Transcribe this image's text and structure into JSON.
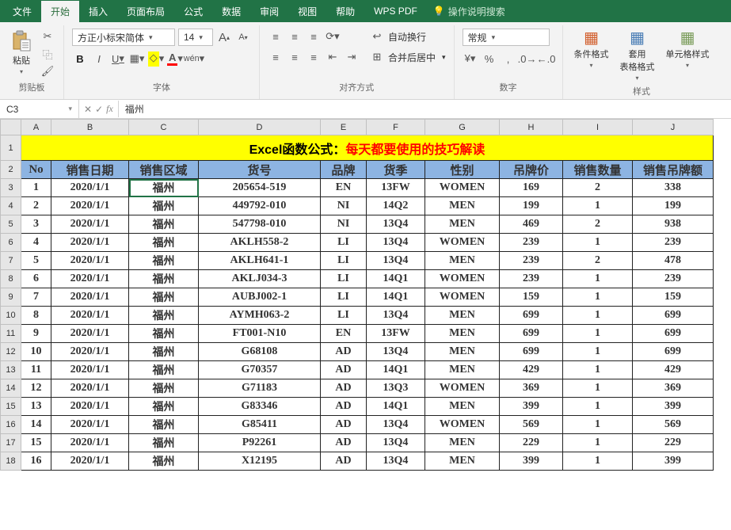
{
  "menubar": {
    "tabs": [
      "文件",
      "开始",
      "插入",
      "页面布局",
      "公式",
      "数据",
      "审阅",
      "视图",
      "帮助",
      "WPS PDF"
    ],
    "active_index": 1,
    "search_placeholder": "操作说明搜索"
  },
  "ribbon": {
    "clipboard": {
      "paste": "粘贴",
      "label": "剪贴板"
    },
    "font": {
      "family": "方正小标宋简体",
      "size": "14",
      "inc": "A",
      "dec": "A",
      "bold": "B",
      "italic": "I",
      "underline": "U",
      "label": "字体"
    },
    "align": {
      "wrap": "自动换行",
      "merge": "合并后居中",
      "label": "对齐方式"
    },
    "number": {
      "format": "常规",
      "label": "数字"
    },
    "styles": {
      "cond": "条件格式",
      "table": "套用\n表格格式",
      "cell": "单元格样式",
      "label": "样式"
    }
  },
  "formula_bar": {
    "name": "C3",
    "value": "福州"
  },
  "grid": {
    "cols": [
      "A",
      "B",
      "C",
      "D",
      "E",
      "F",
      "G",
      "H",
      "I",
      "J"
    ],
    "title_parts": [
      {
        "t": "Excel函数公式：",
        "cls": "t-blk"
      },
      {
        "t": "每天都要使用的技巧解读",
        "cls": "t-red"
      }
    ],
    "headers": [
      "No",
      "销售日期",
      "销售区域",
      "货号",
      "品牌",
      "货季",
      "性别",
      "吊牌价",
      "销售数量",
      "销售吊牌额"
    ],
    "rows": [
      [
        "1",
        "2020/1/1",
        "福州",
        "205654-519",
        "EN",
        "13FW",
        "WOMEN",
        "169",
        "2",
        "338"
      ],
      [
        "2",
        "2020/1/1",
        "福州",
        "449792-010",
        "NI",
        "14Q2",
        "MEN",
        "199",
        "1",
        "199"
      ],
      [
        "3",
        "2020/1/1",
        "福州",
        "547798-010",
        "NI",
        "13Q4",
        "MEN",
        "469",
        "2",
        "938"
      ],
      [
        "4",
        "2020/1/1",
        "福州",
        "AKLH558-2",
        "LI",
        "13Q4",
        "WOMEN",
        "239",
        "1",
        "239"
      ],
      [
        "5",
        "2020/1/1",
        "福州",
        "AKLH641-1",
        "LI",
        "13Q4",
        "MEN",
        "239",
        "2",
        "478"
      ],
      [
        "6",
        "2020/1/1",
        "福州",
        "AKLJ034-3",
        "LI",
        "14Q1",
        "WOMEN",
        "239",
        "1",
        "239"
      ],
      [
        "7",
        "2020/1/1",
        "福州",
        "AUBJ002-1",
        "LI",
        "14Q1",
        "WOMEN",
        "159",
        "1",
        "159"
      ],
      [
        "8",
        "2020/1/1",
        "福州",
        "AYMH063-2",
        "LI",
        "13Q4",
        "MEN",
        "699",
        "1",
        "699"
      ],
      [
        "9",
        "2020/1/1",
        "福州",
        "FT001-N10",
        "EN",
        "13FW",
        "MEN",
        "699",
        "1",
        "699"
      ],
      [
        "10",
        "2020/1/1",
        "福州",
        "G68108",
        "AD",
        "13Q4",
        "MEN",
        "699",
        "1",
        "699"
      ],
      [
        "11",
        "2020/1/1",
        "福州",
        "G70357",
        "AD",
        "14Q1",
        "MEN",
        "429",
        "1",
        "429"
      ],
      [
        "12",
        "2020/1/1",
        "福州",
        "G71183",
        "AD",
        "13Q3",
        "WOMEN",
        "369",
        "1",
        "369"
      ],
      [
        "13",
        "2020/1/1",
        "福州",
        "G83346",
        "AD",
        "14Q1",
        "MEN",
        "399",
        "1",
        "399"
      ],
      [
        "14",
        "2020/1/1",
        "福州",
        "G85411",
        "AD",
        "13Q4",
        "WOMEN",
        "569",
        "1",
        "569"
      ],
      [
        "15",
        "2020/1/1",
        "福州",
        "P92261",
        "AD",
        "13Q4",
        "MEN",
        "229",
        "1",
        "229"
      ],
      [
        "16",
        "2020/1/1",
        "福州",
        "X12195",
        "AD",
        "13Q4",
        "MEN",
        "399",
        "1",
        "399"
      ]
    ],
    "selected": {
      "row": 0,
      "col": 2
    }
  },
  "chart_data": {
    "type": "table",
    "title": "Excel函数公式：每天都要使用的技巧解读",
    "columns": [
      "No",
      "销售日期",
      "销售区域",
      "货号",
      "品牌",
      "货季",
      "性别",
      "吊牌价",
      "销售数量",
      "销售吊牌额"
    ],
    "rows": [
      [
        1,
        "2020/1/1",
        "福州",
        "205654-519",
        "EN",
        "13FW",
        "WOMEN",
        169,
        2,
        338
      ],
      [
        2,
        "2020/1/1",
        "福州",
        "449792-010",
        "NI",
        "14Q2",
        "MEN",
        199,
        1,
        199
      ],
      [
        3,
        "2020/1/1",
        "福州",
        "547798-010",
        "NI",
        "13Q4",
        "MEN",
        469,
        2,
        938
      ],
      [
        4,
        "2020/1/1",
        "福州",
        "AKLH558-2",
        "LI",
        "13Q4",
        "WOMEN",
        239,
        1,
        239
      ],
      [
        5,
        "2020/1/1",
        "福州",
        "AKLH641-1",
        "LI",
        "13Q4",
        "MEN",
        239,
        2,
        478
      ],
      [
        6,
        "2020/1/1",
        "福州",
        "AKLJ034-3",
        "LI",
        "14Q1",
        "WOMEN",
        239,
        1,
        239
      ],
      [
        7,
        "2020/1/1",
        "福州",
        "AUBJ002-1",
        "LI",
        "14Q1",
        "WOMEN",
        159,
        1,
        159
      ],
      [
        8,
        "2020/1/1",
        "福州",
        "AYMH063-2",
        "LI",
        "13Q4",
        "MEN",
        699,
        1,
        699
      ],
      [
        9,
        "2020/1/1",
        "福州",
        "FT001-N10",
        "EN",
        "13FW",
        "MEN",
        699,
        1,
        699
      ],
      [
        10,
        "2020/1/1",
        "福州",
        "G68108",
        "AD",
        "13Q4",
        "MEN",
        699,
        1,
        699
      ],
      [
        11,
        "2020/1/1",
        "福州",
        "G70357",
        "AD",
        "14Q1",
        "MEN",
        429,
        1,
        429
      ],
      [
        12,
        "2020/1/1",
        "福州",
        "G71183",
        "AD",
        "13Q3",
        "WOMEN",
        369,
        1,
        369
      ],
      [
        13,
        "2020/1/1",
        "福州",
        "G83346",
        "AD",
        "14Q1",
        "MEN",
        399,
        1,
        399
      ],
      [
        14,
        "2020/1/1",
        "福州",
        "G85411",
        "AD",
        "13Q4",
        "WOMEN",
        569,
        1,
        569
      ],
      [
        15,
        "2020/1/1",
        "福州",
        "P92261",
        "AD",
        "13Q4",
        "MEN",
        229,
        1,
        229
      ],
      [
        16,
        "2020/1/1",
        "福州",
        "X12195",
        "AD",
        "13Q4",
        "MEN",
        399,
        1,
        399
      ]
    ]
  }
}
